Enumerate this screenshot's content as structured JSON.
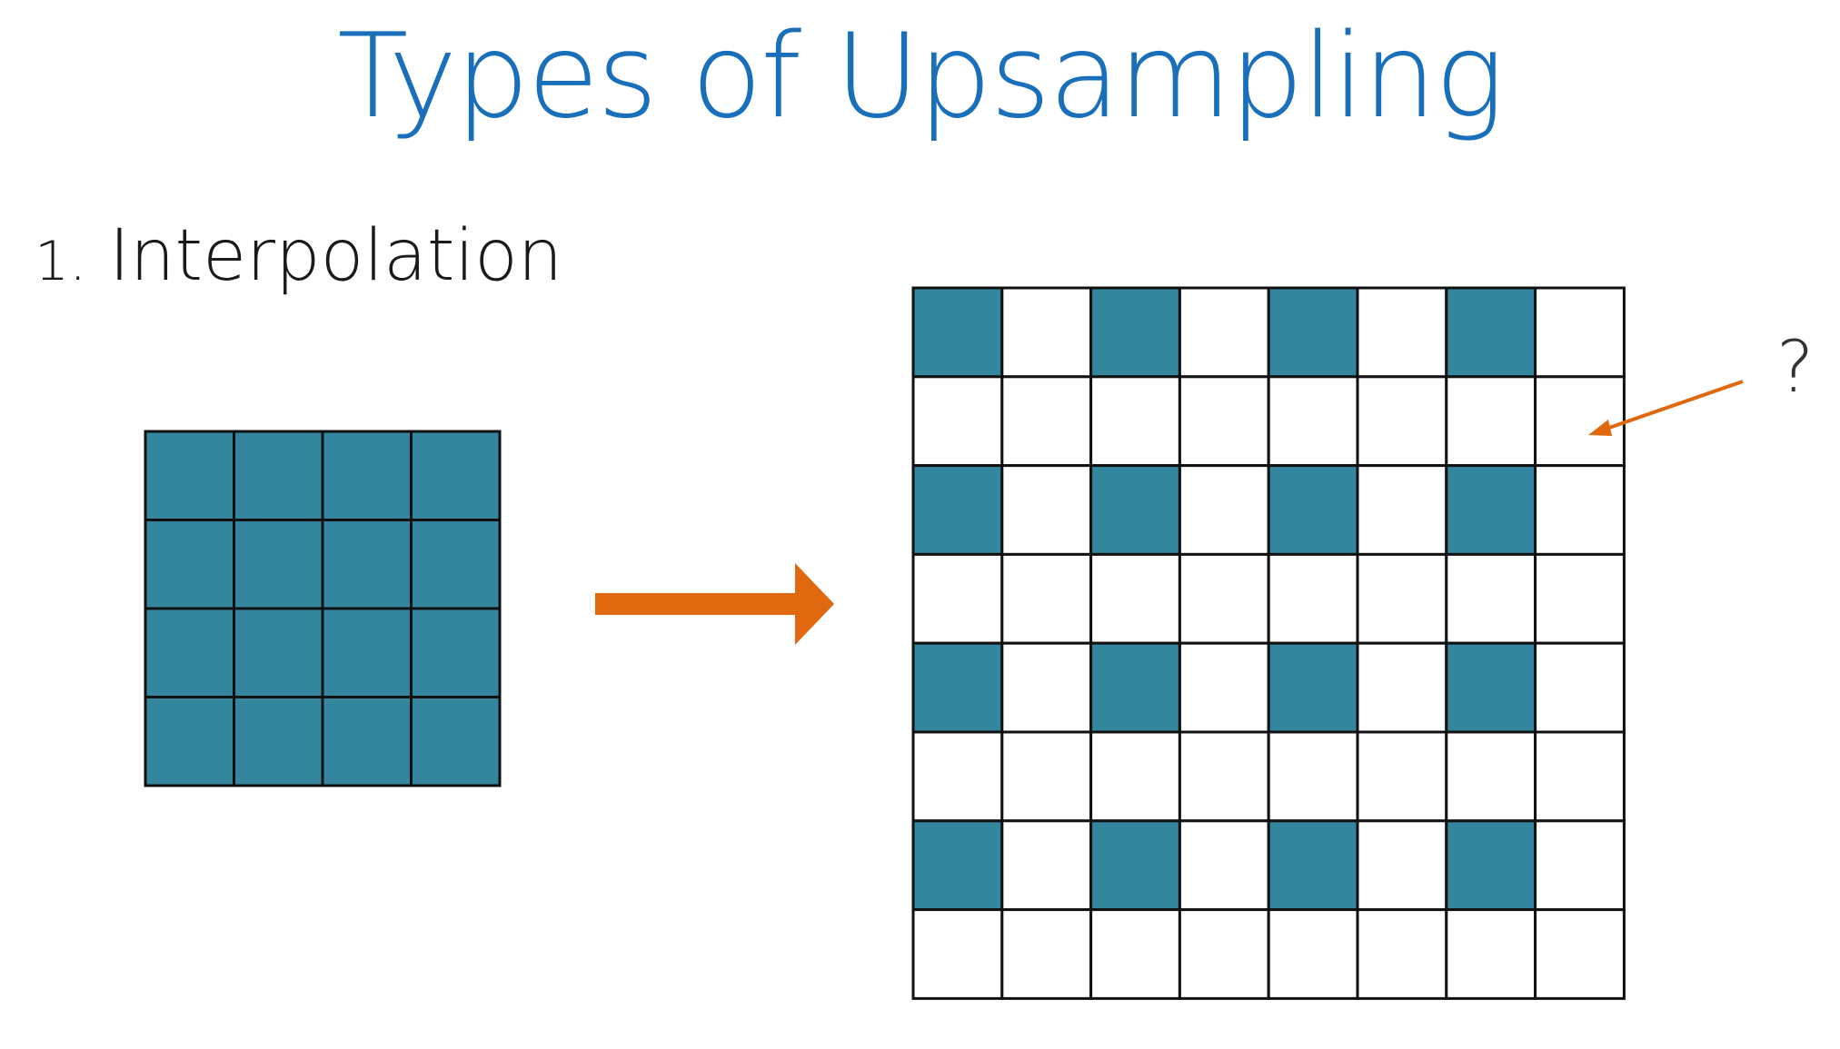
{
  "slide": {
    "title": "Types of Upsampling",
    "subtitle_number": "1.",
    "subtitle_text": "Interpolation",
    "question_label": "?"
  },
  "colors": {
    "title": "#1a6fba",
    "filled_cell": "#33869e",
    "empty_cell": "#ffffff",
    "grid_line": "#111111",
    "arrow": "#e0690f"
  },
  "input_grid": {
    "rows": 4,
    "cols": 4
  },
  "output_grid": {
    "rows": 8,
    "cols": 8,
    "fill_pattern": "even-row-and-even-col"
  }
}
